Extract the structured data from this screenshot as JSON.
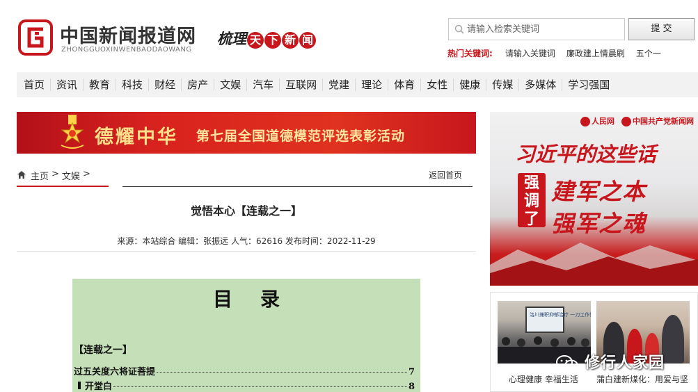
{
  "header": {
    "site_name": "中国新闻报道网",
    "site_pinyin": "ZHONGGUOXINWENBAODAOWANG",
    "slogan_plain": "梳理",
    "slogan_chars": [
      "天",
      "下",
      "新",
      "闻"
    ],
    "search_placeholder": "请输入检索关键词",
    "submit_label": "提 交",
    "hot_keywords_label": "热门关键词:",
    "hot_keywords": [
      "请输入关键词",
      "廉政建上情晨刷",
      "五个一"
    ],
    "accent_color": "#c8161d"
  },
  "nav": {
    "items": [
      "首页",
      "资讯",
      "教育",
      "科技",
      "财经",
      "房产",
      "文娱",
      "汽车",
      "互联网",
      "党建",
      "理论",
      "体育",
      "女性",
      "健康",
      "传媒",
      "多媒体",
      "学习强国"
    ]
  },
  "banner": {
    "title": "德耀中华",
    "subtitle": "第七届全国道德模范评选表彰活动"
  },
  "breadcrumb": {
    "items": [
      "主页",
      ">",
      "文娱",
      ">"
    ],
    "back_home": "返回首页"
  },
  "article": {
    "title": "觉悟本心【连载之一】",
    "meta": "来源：本站综合  编辑：张振远 人气：62616 发布时间：2022-11-29"
  },
  "toc": {
    "title": "目录",
    "section": "【连载之一】",
    "rows": [
      {
        "label": "过五关度六将证菩提",
        "page": "7"
      },
      {
        "label": "开堂白",
        "page": "8"
      }
    ]
  },
  "side_banner": {
    "logo_left": "人民网",
    "logo_right": "中国共产党新闻网",
    "main": "习近平的这些话",
    "badge": "强调了",
    "line1": "建军之本",
    "line2": "强军之魂"
  },
  "side_box": {
    "photo1_screen": "洛川兼职抑郁治疗 一刀工作健康学习",
    "caption1": "心理健康 幸福生活",
    "caption2": "蒲白建新煤化：用爱与坚",
    "watermark": "修行人家园"
  }
}
